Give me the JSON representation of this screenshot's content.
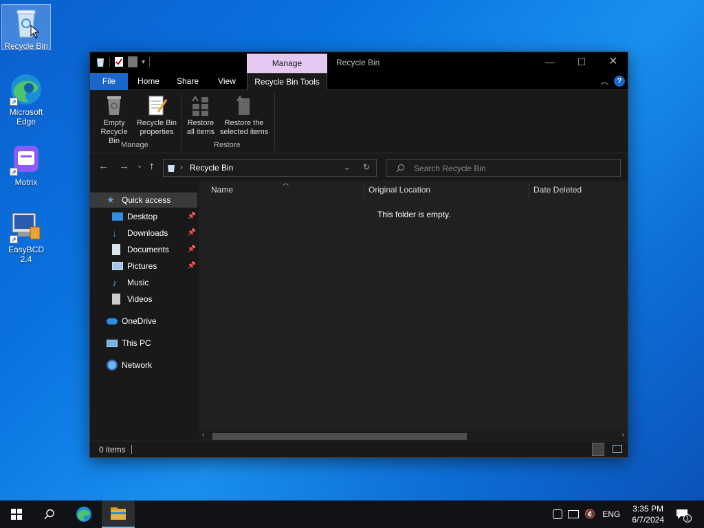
{
  "desktop": {
    "icons": [
      {
        "label": "Recycle Bin"
      },
      {
        "label": "Microsoft Edge"
      },
      {
        "label": "Motrix"
      },
      {
        "label": "EasyBCD 2.4"
      }
    ]
  },
  "window": {
    "title": "Recycle Bin",
    "contextual_tab_group": "Manage",
    "controls": {
      "minimize": "—",
      "maximize": "☐",
      "close": "✕"
    }
  },
  "ribbon": {
    "tabs": [
      "File",
      "Home",
      "Share",
      "View",
      "Recycle Bin Tools"
    ],
    "active_tab": "Recycle Bin Tools",
    "groups": [
      {
        "label": "Manage",
        "buttons": [
          {
            "line1": "Empty",
            "line2": "Recycle Bin"
          },
          {
            "line1": "Recycle Bin",
            "line2": "properties"
          }
        ]
      },
      {
        "label": "Restore",
        "buttons": [
          {
            "line1": "Restore",
            "line2": "all items"
          },
          {
            "line1": "Restore the",
            "line2": "selected items"
          }
        ]
      }
    ]
  },
  "address": {
    "path": "Recycle Bin",
    "separator": "›",
    "search_placeholder": "Search Recycle Bin"
  },
  "nav_pane": {
    "quick_access": "Quick access",
    "pinned": [
      "Desktop",
      "Downloads",
      "Documents",
      "Pictures"
    ],
    "unpinned": [
      "Music",
      "Videos"
    ],
    "onedrive": "OneDrive",
    "this_pc": "This PC",
    "network": "Network"
  },
  "file_list": {
    "columns": [
      "Name",
      "Original Location",
      "Date Deleted"
    ],
    "empty_message": "This folder is empty."
  },
  "status": {
    "items": "0 items"
  },
  "taskbar": {
    "language": "ENG",
    "time": "3:35 PM",
    "date": "6/7/2024",
    "notification_count": "1"
  },
  "colors": {
    "file_tab": "#1a66c9",
    "manage_tab": "#e6c9f2",
    "window_bg": "#191919",
    "taskbar_bg": "#101216"
  }
}
